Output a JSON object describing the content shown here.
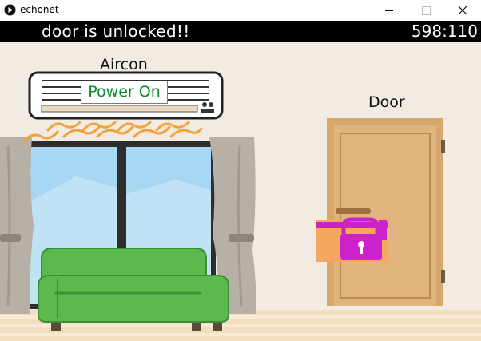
{
  "window": {
    "title": "echonet",
    "controls": {
      "minimize": "—",
      "maximize": "☐",
      "close": "✕"
    }
  },
  "status": {
    "message": "door is unlocked!!",
    "counter": "598:110"
  },
  "aircon": {
    "label": "Aircon",
    "state": "Power On",
    "state_color": "#0b8a2a"
  },
  "door": {
    "label": "Door",
    "lock_icon_color": "#cc22cc",
    "lock_panel_color": "#f5a760",
    "locked": false
  },
  "icons": [
    "app-play-icon",
    "padlock-icon",
    "airflow-icon"
  ]
}
